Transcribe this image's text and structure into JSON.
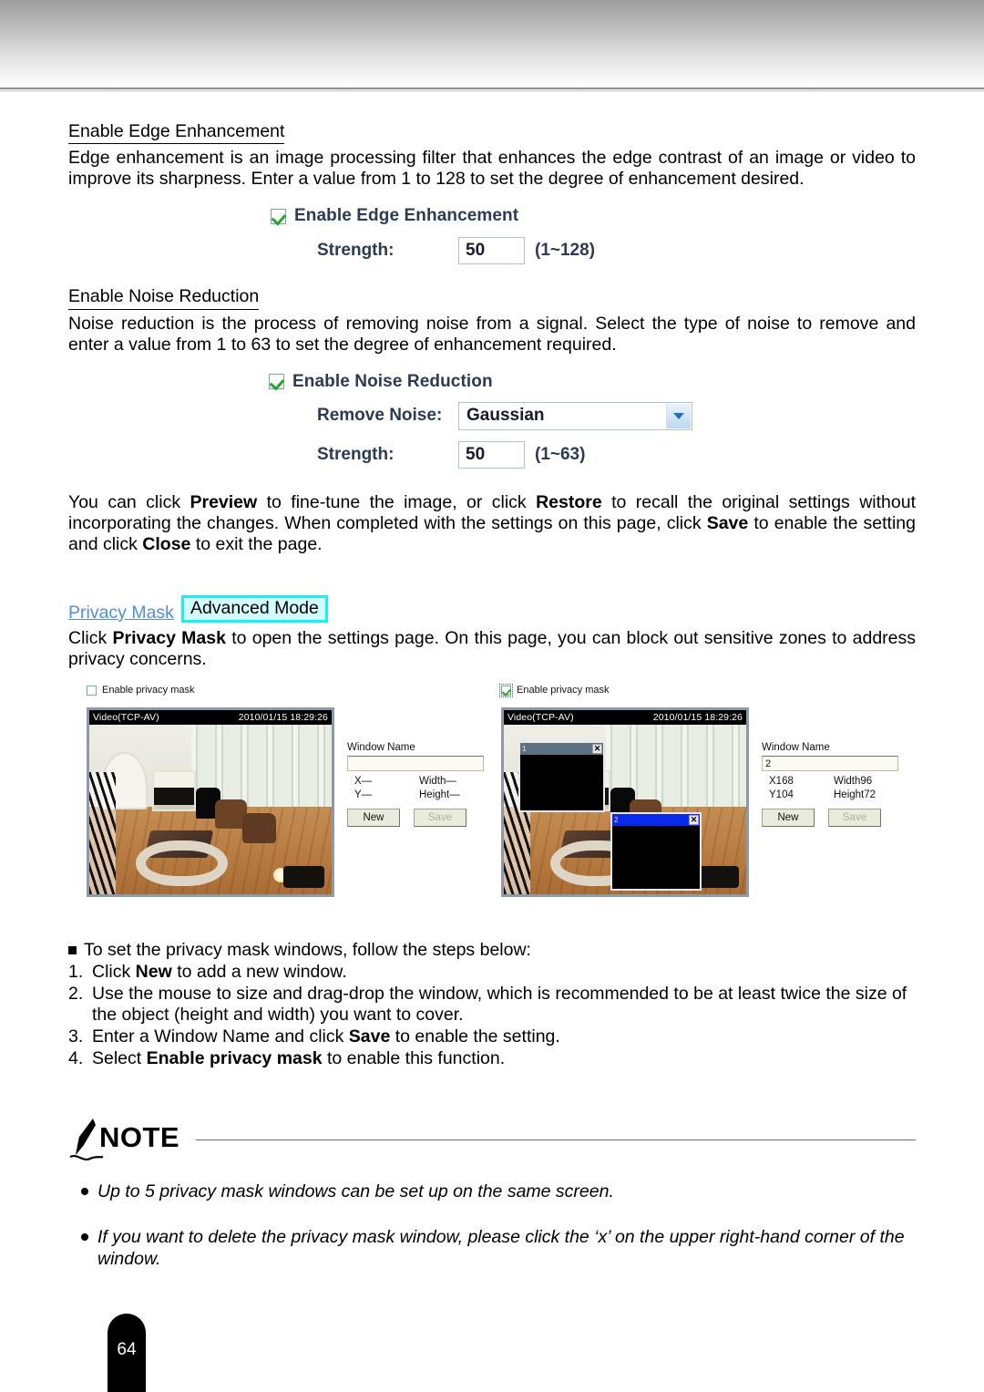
{
  "page": {
    "number": "64"
  },
  "edge": {
    "heading": "Enable Edge Enhancement",
    "paragraph": "Edge enhancement is an image processing filter that enhances the edge contrast of an image or video to improve its sharpness. Enter a value from 1 to 128 to set the degree of enhancement desired.",
    "checkbox_label": "Enable Edge Enhancement",
    "checkbox_checked": true,
    "strength_label": "Strength:",
    "strength_value": "50",
    "strength_hint": "(1~128)"
  },
  "noise": {
    "heading": "Enable Noise Reduction",
    "paragraph": "Noise reduction is the process of removing noise from a signal. Select the type of noise to remove and enter a value from 1 to 63 to set the degree of enhancement required.",
    "checkbox_label": "Enable Noise Reduction",
    "checkbox_checked": true,
    "remove_noise_label": "Remove Noise:",
    "remove_noise_value": "Gaussian",
    "strength_label": "Strength:",
    "strength_value": "50",
    "strength_hint": "(1~63)"
  },
  "preview_paragraph": {
    "p1": "You can click ",
    "b1": "Preview",
    "p2": " to fine-tune the image, or click ",
    "b2": "Restore",
    "p3": " to recall the original settings without incorporating the changes. When completed with the settings on this page, click ",
    "b3": "Save",
    "p4": " to enable the setting and click ",
    "b4": "Close",
    "p5": " to exit the page."
  },
  "privacy_mask": {
    "link_label": "Privacy Mask",
    "badge_label": "Advanced Mode",
    "intro_p1": "Click ",
    "intro_b1": "Privacy Mask",
    "intro_p2": " to open the settings page. On this page, you can block out sensitive zones to address privacy concerns."
  },
  "screenshot_left": {
    "enable_label": "Enable privacy mask",
    "enable_checked": false,
    "viewer_stream": "Video(TCP-AV)",
    "viewer_timestamp": "2010/01/15 18:29:26",
    "window_name_title": "Window Name",
    "window_name_value": "",
    "x_label": "X—",
    "y_label": "Y—",
    "width_label": "Width—",
    "height_label": "Height—",
    "new_button": "New",
    "save_button": "Save",
    "mask_windows": []
  },
  "screenshot_right": {
    "enable_label": "Enable privacy mask",
    "enable_checked": true,
    "viewer_stream": "Video(TCP-AV)",
    "viewer_timestamp": "2010/01/15 18:29:26",
    "window_name_title": "Window Name",
    "window_name_value": "2",
    "x_label": "X168",
    "y_label": "Y104",
    "width_label": "Width96",
    "height_label": "Height72",
    "new_button": "New",
    "save_button": "Save",
    "mask_windows": [
      {
        "id": "1",
        "close": "✕",
        "state": "inactive"
      },
      {
        "id": "2",
        "close": "✕",
        "state": "active"
      }
    ]
  },
  "steps": {
    "intro": "To set the privacy mask windows, follow the steps below:",
    "items": [
      {
        "n": "1.",
        "p1": "Click ",
        "b": "New",
        "p2": " to add a new window."
      },
      {
        "n": "2.",
        "p1": "Use the mouse to size and drag-drop the window, which is recommended to be at least twice the size of the object (height and width) you want to cover.",
        "b": "",
        "p2": ""
      },
      {
        "n": "3.",
        "p1": "Enter a Window Name and click ",
        "b": "Save",
        "p2": " to enable the setting."
      },
      {
        "n": "4.",
        "p1": "Select ",
        "b": "Enable privacy mask",
        "p2": " to enable this function."
      }
    ]
  },
  "note": {
    "title": "NOTE",
    "items": [
      "Up to 5 privacy mask windows can be set up on the same screen.",
      "If you want to delete the privacy mask window, please click the ‘x’ on the upper right-hand corner of the window."
    ]
  }
}
